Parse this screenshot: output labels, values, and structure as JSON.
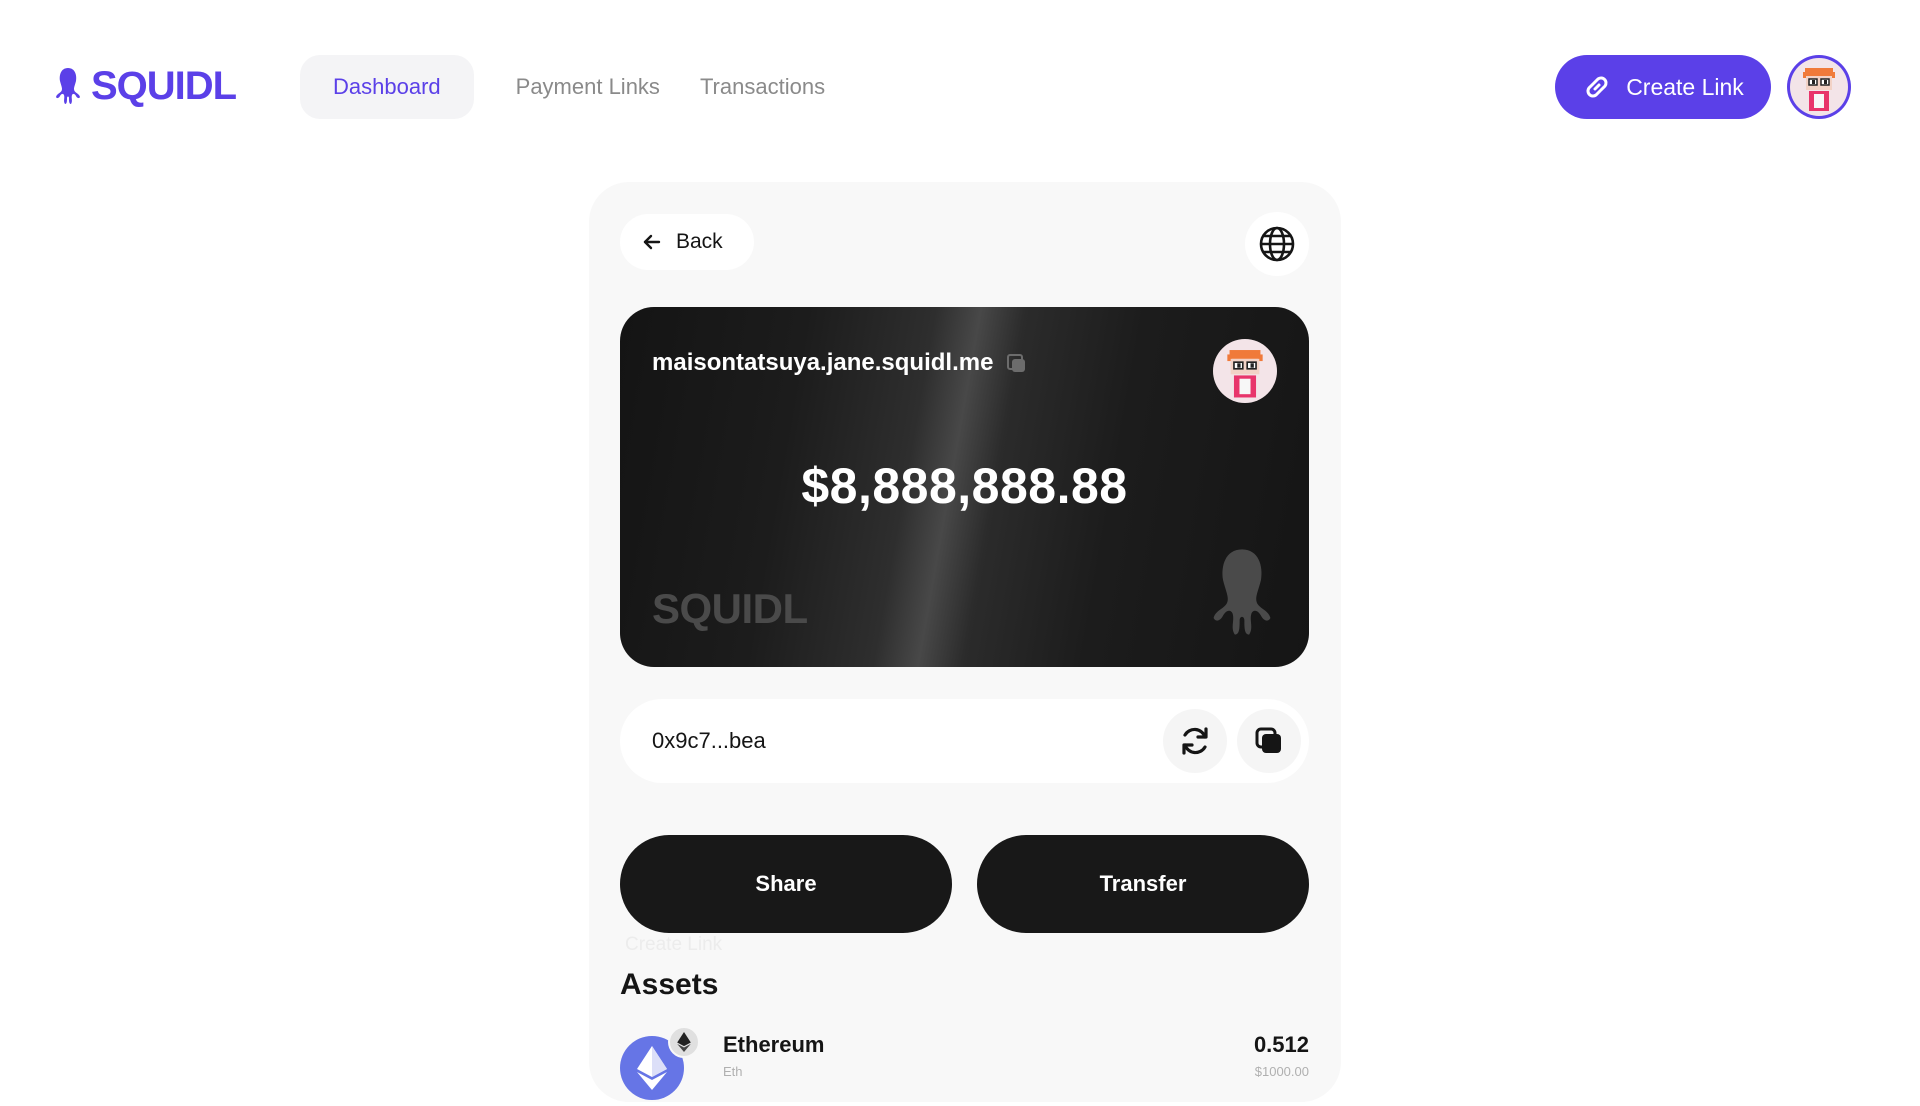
{
  "app": {
    "brand": "SQUIDL",
    "accent_color": "#5b40e8"
  },
  "nav": {
    "items": [
      {
        "label": "Dashboard",
        "active": true
      },
      {
        "label": "Payment Links",
        "active": false
      },
      {
        "label": "Transactions",
        "active": false
      }
    ]
  },
  "header": {
    "create_label": "Create Link",
    "create_icon": "link-icon",
    "avatar": "pixel-avatar"
  },
  "panel": {
    "back_label": "Back",
    "back_icon": "arrow-left-icon",
    "globe_icon": "globe-icon"
  },
  "card": {
    "handle": "maisontatsuya.jane.squidl.me",
    "balance": "$8,888,888.88",
    "brand": "SQUIDL",
    "copy_icon": "copy-icon",
    "mascot_icon": "squid-icon"
  },
  "address": {
    "value": "0x9c7...bea",
    "refresh_icon": "refresh-icon",
    "copy_icon": "copy-icon"
  },
  "actions": {
    "share_label": "Share",
    "transfer_label": "Transfer",
    "ghost_label": "Create Link"
  },
  "assets": {
    "title": "Assets",
    "items": [
      {
        "name": "Ethereum",
        "symbol": "Eth",
        "amount": "0.512",
        "usd": "$1000.00"
      }
    ]
  }
}
